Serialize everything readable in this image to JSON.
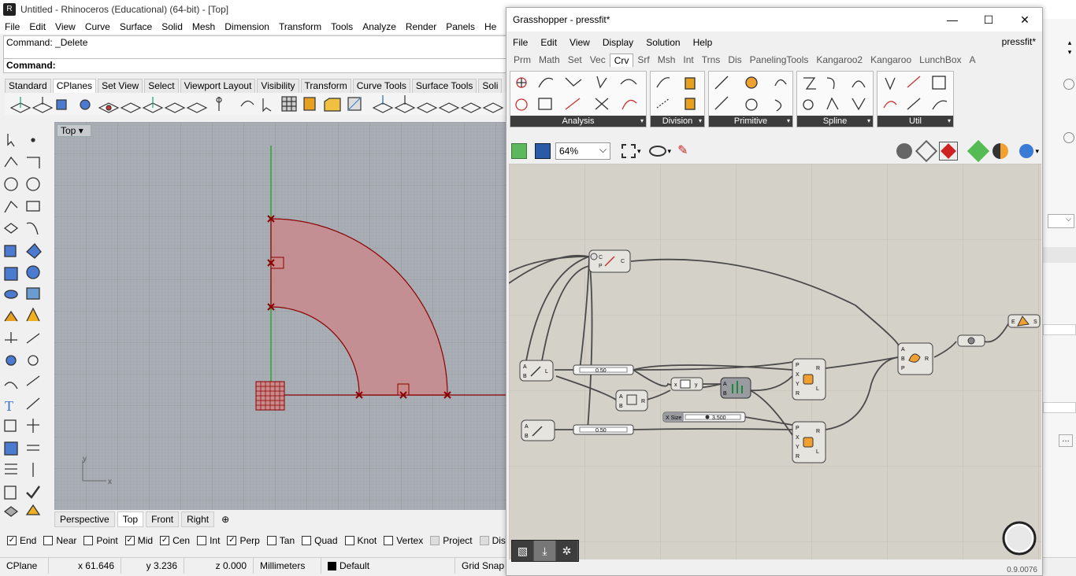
{
  "rhino": {
    "title": "Untitled - Rhinoceros (Educational) (64-bit) - [Top]",
    "menu": [
      "File",
      "Edit",
      "View",
      "Curve",
      "Surface",
      "Solid",
      "Mesh",
      "Dimension",
      "Transform",
      "Tools",
      "Analyze",
      "Render",
      "Panels",
      "He"
    ],
    "command_history": "Command: _Delete",
    "command_prompt": "Command:",
    "toolbar_tabs": [
      "Standard",
      "CPlanes",
      "Set View",
      "Select",
      "Viewport Layout",
      "Visibility",
      "Transform",
      "Curve Tools",
      "Surface Tools",
      "Soli"
    ],
    "active_toolbar_tab": "CPlanes",
    "viewport_label": "Top",
    "viewport_tabs": [
      "Perspective",
      "Top",
      "Front",
      "Right"
    ],
    "active_viewport_tab": "Top",
    "axis_x": "x",
    "axis_y": "y",
    "osnaps": [
      {
        "label": "End",
        "checked": true
      },
      {
        "label": "Near",
        "checked": false
      },
      {
        "label": "Point",
        "checked": false
      },
      {
        "label": "Mid",
        "checked": true
      },
      {
        "label": "Cen",
        "checked": true
      },
      {
        "label": "Int",
        "checked": false
      },
      {
        "label": "Perp",
        "checked": true
      },
      {
        "label": "Tan",
        "checked": false
      },
      {
        "label": "Quad",
        "checked": false
      },
      {
        "label": "Knot",
        "checked": false
      },
      {
        "label": "Vertex",
        "checked": false
      },
      {
        "label": "Project",
        "checked": false
      },
      {
        "label": "Disable",
        "checked": false
      }
    ],
    "status": {
      "cplane": "CPlane",
      "x": "x 61.646",
      "y": "y 3.236",
      "z": "z 0.000",
      "units": "Millimeters",
      "layer": "Default",
      "gridsnap": "Grid Snap"
    }
  },
  "grasshopper": {
    "title": "Grasshopper - pressfit*",
    "menu": [
      "File",
      "Edit",
      "View",
      "Display",
      "Solution",
      "Help"
    ],
    "document": "pressfit*",
    "tabs": [
      "Prm",
      "Math",
      "Set",
      "Vec",
      "Crv",
      "Srf",
      "Msh",
      "Int",
      "Trns",
      "Dis",
      "PanelingTools",
      "Kangaroo2",
      "Kangaroo",
      "LunchBox",
      "A"
    ],
    "active_tab": "Crv",
    "groups": [
      "Analysis",
      "Division",
      "Primitive",
      "Spline",
      "Util"
    ],
    "zoom": "64%",
    "slider_1": "0.50",
    "slider_2": "0.50",
    "slider_x_label": "X Size",
    "slider_x_value": "3.500",
    "version": "0.9.0076"
  },
  "colors": {
    "shape_fill": "#c98a8c",
    "shape_stroke": "#8b0000",
    "green_axis": "#1aa51a",
    "canvas": "#d4d1c9",
    "viewport": "#a9adb4"
  }
}
